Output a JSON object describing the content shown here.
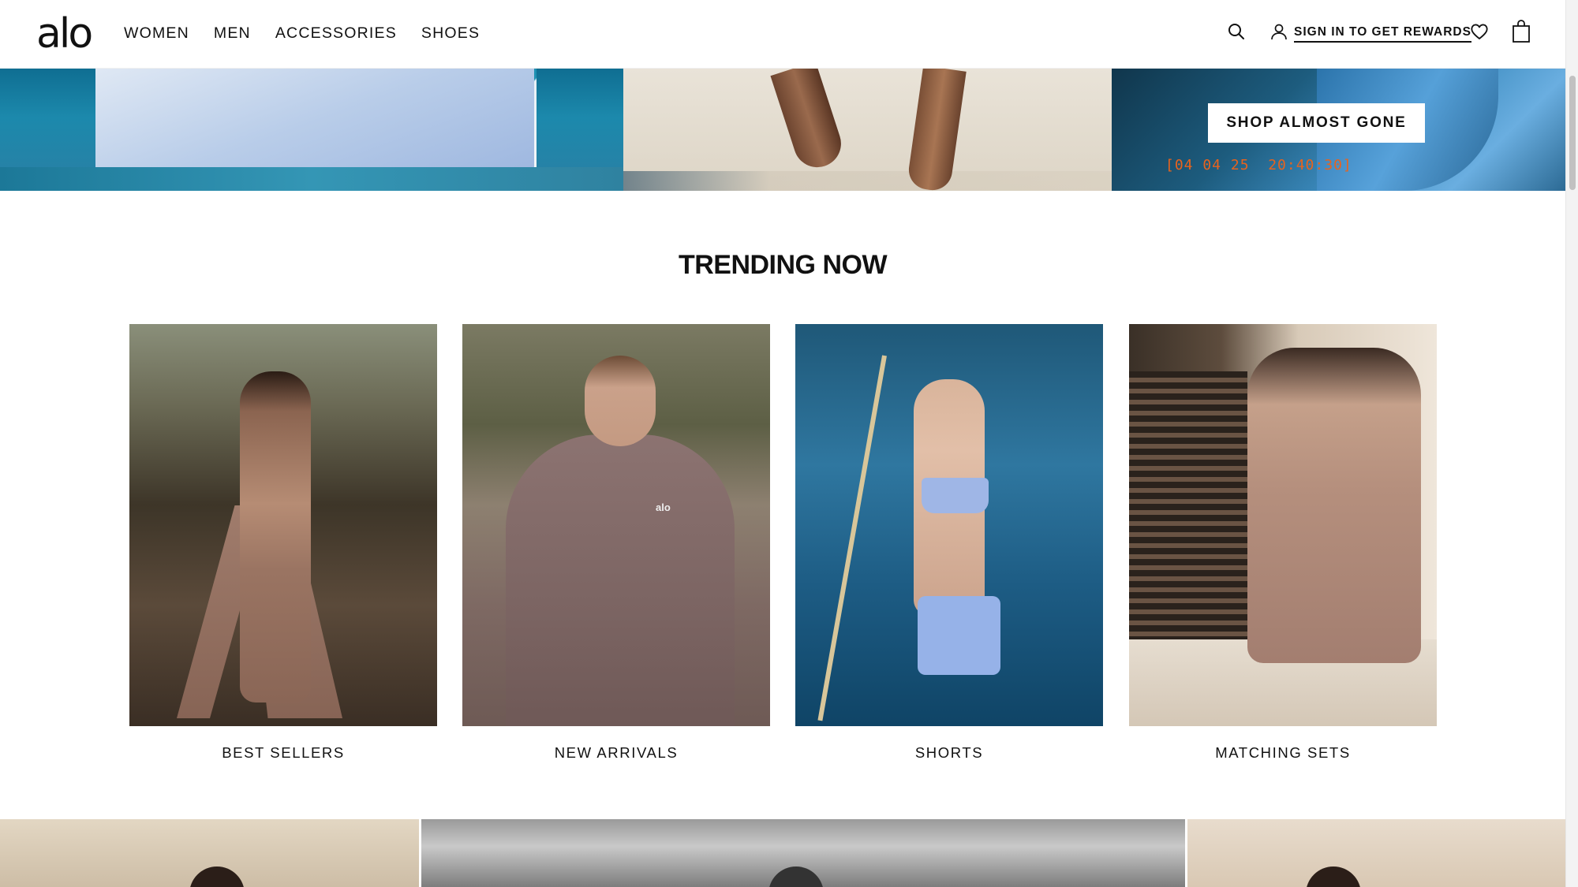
{
  "brand": {
    "logo_text": "alo"
  },
  "nav": {
    "items": [
      {
        "label": "WOMEN"
      },
      {
        "label": "MEN"
      },
      {
        "label": "ACCESSORIES"
      },
      {
        "label": "SHOES"
      }
    ]
  },
  "header": {
    "search_icon": "search-icon",
    "signin_label": "SIGN IN TO GET REWARDS",
    "wishlist_icon": "heart-icon",
    "bag_icon": "shopping-bag-icon"
  },
  "hero": {
    "cta_label": "SHOP ALMOST GONE",
    "countdown": "[04 04 25  20:40:30]",
    "countdown_color": "#e8631d"
  },
  "trending": {
    "title": "TRENDING NOW",
    "cards": [
      {
        "label": "BEST SELLERS"
      },
      {
        "label": "NEW ARRIVALS"
      },
      {
        "label": "SHORTS"
      },
      {
        "label": "MATCHING SETS"
      }
    ],
    "sweatshirt_logo": "alo"
  }
}
